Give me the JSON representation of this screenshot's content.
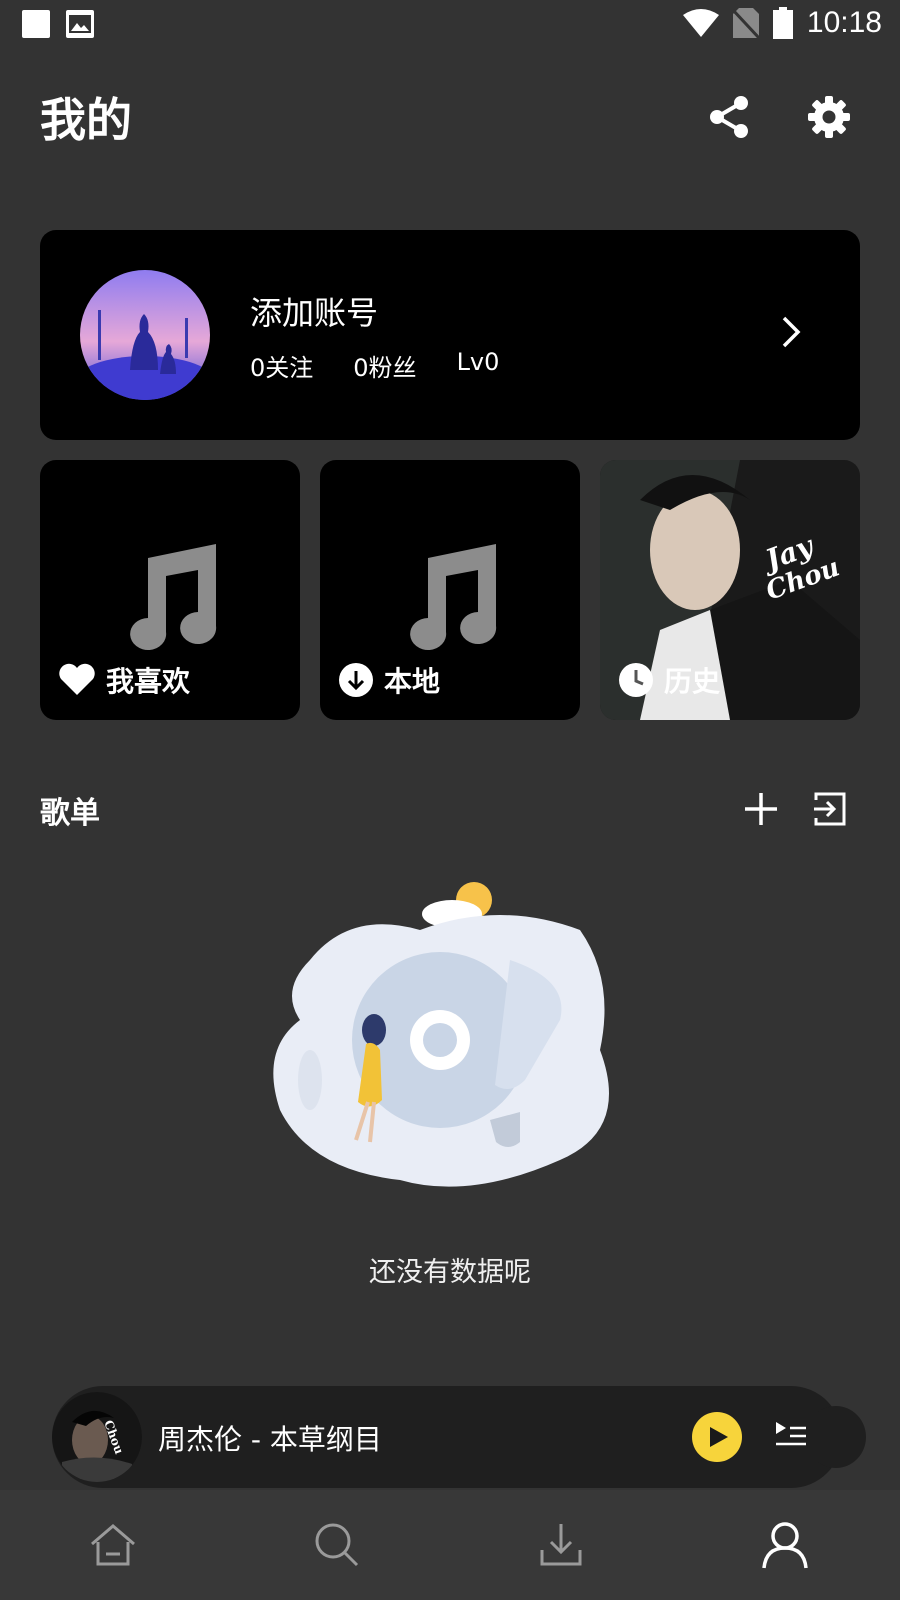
{
  "status_bar": {
    "time": "10:18",
    "icons": [
      "notification-square-icon",
      "image-icon",
      "wifi-icon",
      "no-sim-icon",
      "battery-icon"
    ]
  },
  "header": {
    "title": "我的",
    "icons": [
      "share-icon",
      "settings-gear-icon"
    ]
  },
  "account": {
    "name": "添加账号",
    "following": "0关注",
    "followers": "0粉丝",
    "level": "Lv0"
  },
  "tiles": [
    {
      "label": "我喜欢",
      "icon": "heart-icon"
    },
    {
      "label": "本地",
      "icon": "download-circle-icon"
    },
    {
      "label": "历史",
      "icon": "clock-icon"
    }
  ],
  "playlist_section": {
    "title": "歌单",
    "icons": [
      "add-icon",
      "import-icon"
    ],
    "empty_text": "还没有数据呢"
  },
  "mini_player": {
    "track": "周杰伦 - 本草纲目",
    "icons": [
      "play-icon",
      "playlist-queue-icon"
    ]
  },
  "bottom_nav": {
    "items": [
      "home-icon",
      "search-icon",
      "download-icon",
      "profile-icon"
    ],
    "active": "profile-icon"
  },
  "colors": {
    "background": "#333333",
    "card": "#000000",
    "accent": "#f7d43b"
  }
}
